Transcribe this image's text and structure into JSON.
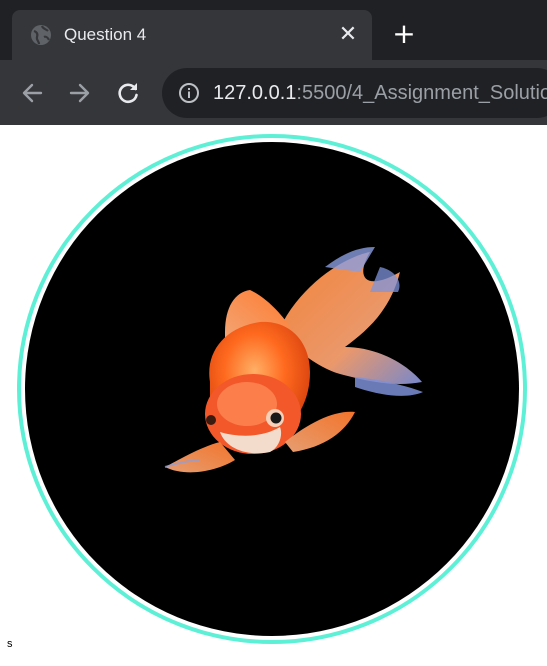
{
  "browser": {
    "tab": {
      "title": "Question 4",
      "close_glyph": "✕"
    },
    "new_tab_glyph": "+",
    "address": {
      "host": "127.0.0.1",
      "path": ":5500/4_Assignment_Solutio"
    }
  },
  "page": {
    "caption": "s"
  },
  "colors": {
    "ring": "#5ef0d6",
    "circle_fill": "#000000"
  }
}
